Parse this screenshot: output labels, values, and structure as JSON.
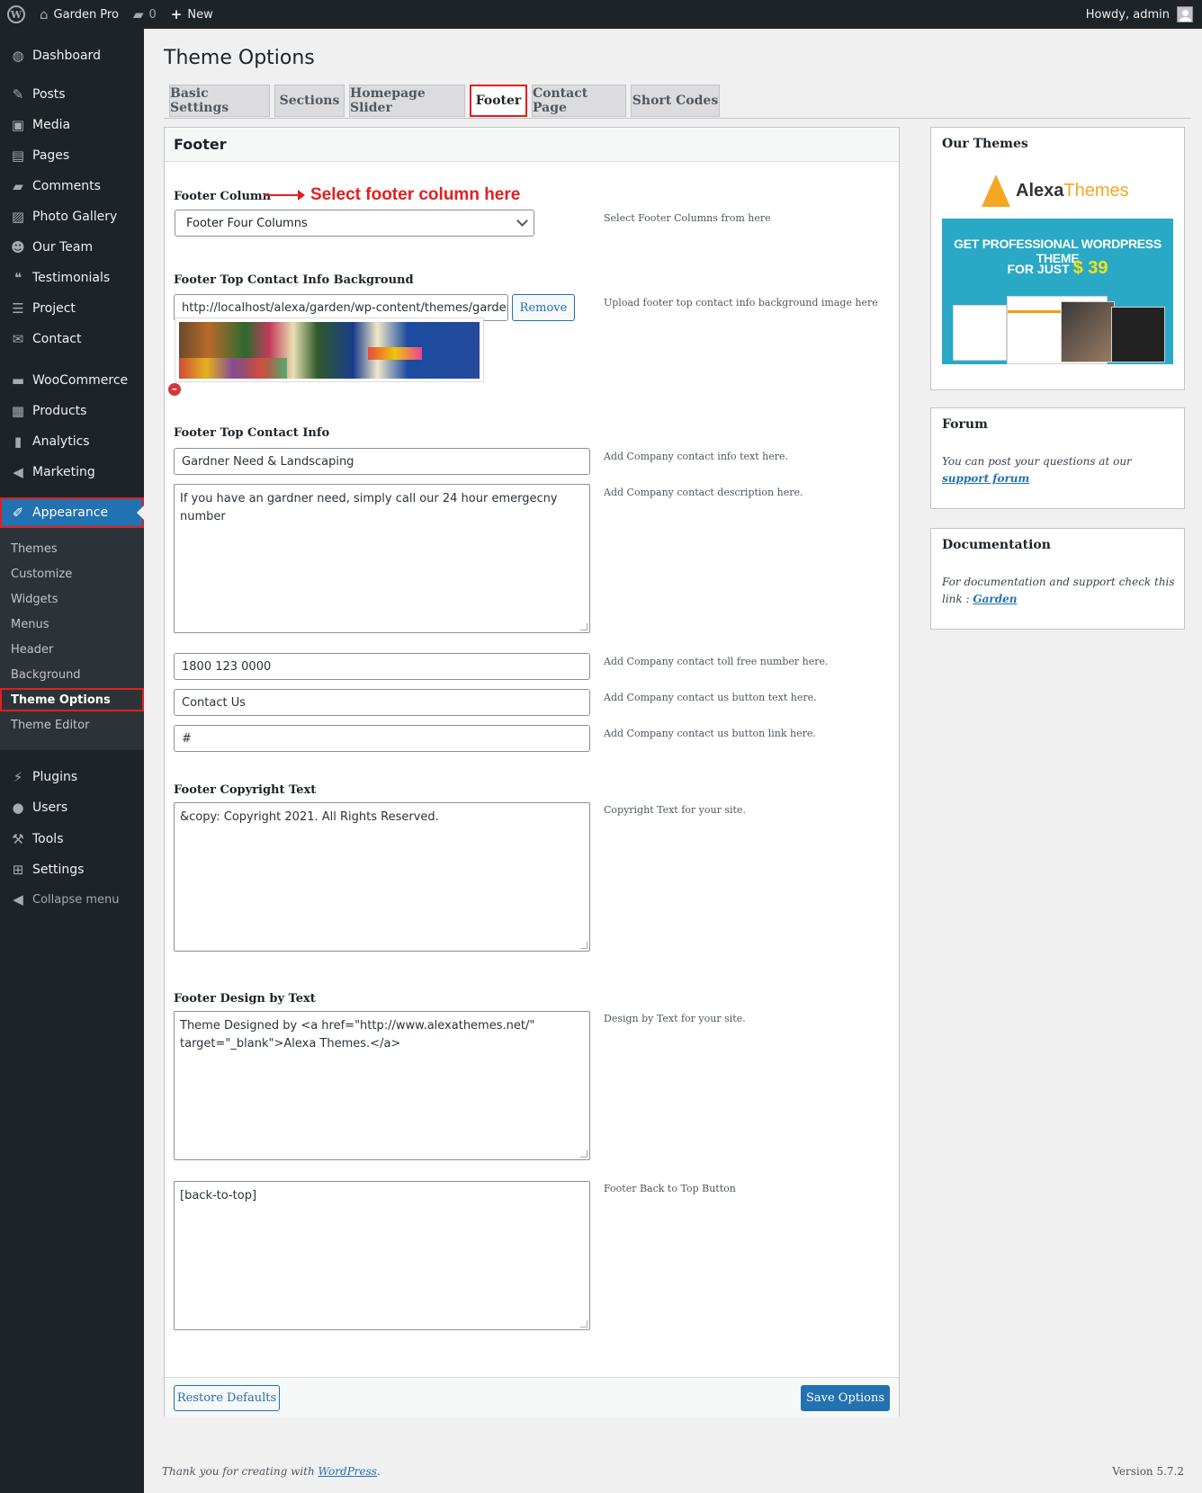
{
  "adminbar": {
    "site_name": "Garden Pro",
    "comments_count": "0",
    "new_label": "New",
    "greeting": "Howdy, admin"
  },
  "sidebar": {
    "items": [
      {
        "label": "Dashboard",
        "icon": "dashboard-icon",
        "glyph": "◍"
      },
      {
        "label": "Posts",
        "icon": "pin-icon",
        "glyph": "✎"
      },
      {
        "label": "Media",
        "icon": "media-icon",
        "glyph": "▣"
      },
      {
        "label": "Pages",
        "icon": "pages-icon",
        "glyph": "▤"
      },
      {
        "label": "Comments",
        "icon": "comment-icon",
        "glyph": "▰"
      },
      {
        "label": "Photo Gallery",
        "icon": "gallery-icon",
        "glyph": "▨"
      },
      {
        "label": "Our Team",
        "icon": "team-icon",
        "glyph": "☻"
      },
      {
        "label": "Testimonials",
        "icon": "quote-icon",
        "glyph": "❝"
      },
      {
        "label": "Project",
        "icon": "list-icon",
        "glyph": "☰"
      },
      {
        "label": "Contact",
        "icon": "mail-icon",
        "glyph": "✉"
      },
      {
        "label": "WooCommerce",
        "icon": "woo-icon",
        "glyph": "▬"
      },
      {
        "label": "Products",
        "icon": "archive-icon",
        "glyph": "▦"
      },
      {
        "label": "Analytics",
        "icon": "bar-chart-icon",
        "glyph": "▮"
      },
      {
        "label": "Marketing",
        "icon": "megaphone-icon",
        "glyph": "◀"
      },
      {
        "label": "Appearance",
        "icon": "brush-icon",
        "glyph": "✐"
      },
      {
        "label": "Plugins",
        "icon": "plugin-icon",
        "glyph": "⚡"
      },
      {
        "label": "Users",
        "icon": "user-icon",
        "glyph": "●"
      },
      {
        "label": "Tools",
        "icon": "wrench-icon",
        "glyph": "⚒"
      },
      {
        "label": "Settings",
        "icon": "settings-icon",
        "glyph": "⊞"
      },
      {
        "label": "Collapse menu",
        "icon": "collapse-icon",
        "glyph": "◀"
      }
    ],
    "submenu": [
      "Themes",
      "Customize",
      "Widgets",
      "Menus",
      "Header",
      "Background",
      "Theme Options",
      "Theme Editor"
    ]
  },
  "page": {
    "title": "Theme Options",
    "tabs": [
      "Basic Settings",
      "Sections",
      "Homepage Slider",
      "Footer",
      "Contact Page",
      "Short Codes"
    ],
    "active_tab": "Footer"
  },
  "panel": {
    "heading": "Footer",
    "footer_column_label": "Footer Column",
    "annotation": "Select footer column here",
    "footer_column_value": "Footer Four Columns",
    "footer_column_help": "Select Footer Columns from here",
    "bg_label": "Footer Top Contact Info Background",
    "bg_url": "http://localhost/alexa/garden/wp-content/themes/garden-",
    "bg_remove": "Remove",
    "bg_help": "Upload footer top contact info background image here",
    "remove_image_glyph": "–",
    "contact_label": "Footer Top Contact Info",
    "contact_title": "Gardner Need & Landscaping",
    "contact_title_help": "Add Company contact info text here.",
    "contact_desc": "If you have an gardner need, simply call our 24 hour emergecny number",
    "contact_desc_help": "Add Company contact description here.",
    "toll_free": "1800 123 0000",
    "toll_free_help": "Add Company contact toll free number here.",
    "button_text": "Contact Us",
    "button_text_help": "Add Company contact us button text here.",
    "button_link": "#",
    "button_link_help": "Add Company contact us button link here.",
    "copyright_label": "Footer Copyright Text",
    "copyright_value": "&copy: Copyright 2021. All Rights Reserved.",
    "copyright_help": "Copyright Text for your site.",
    "design_label": "Footer Design by Text",
    "design_value": "Theme Designed by <a href=\"http://www.alexathemes.net/\"\ntarget=\"_blank\">Alexa Themes.</a>",
    "design_help": "Design by Text for your site.",
    "backtop_value": "[back-to-top]",
    "backtop_help": "Footer Back to Top Button",
    "restore_label": "Restore Defaults",
    "save_label": "Save Options"
  },
  "widgets": {
    "themes_title": "Our Themes",
    "logo_part1": "Alexa",
    "logo_part2": "Themes",
    "promo_line1": "GET PROFESSIONAL WORDPRESS THEME",
    "promo_line2": "FOR JUST",
    "promo_price": "$ 39",
    "forum_title": "Forum",
    "forum_text": "You can post your questions at our ",
    "forum_link": "support forum",
    "doc_title": "Documentation",
    "doc_text": "For documentation and support check this link : ",
    "doc_link": "Garden"
  },
  "footer": {
    "thanks_text": "Thank you for creating with ",
    "wp_link": "WordPress",
    "thanks_end": ".",
    "version": "Version 5.7.2"
  }
}
